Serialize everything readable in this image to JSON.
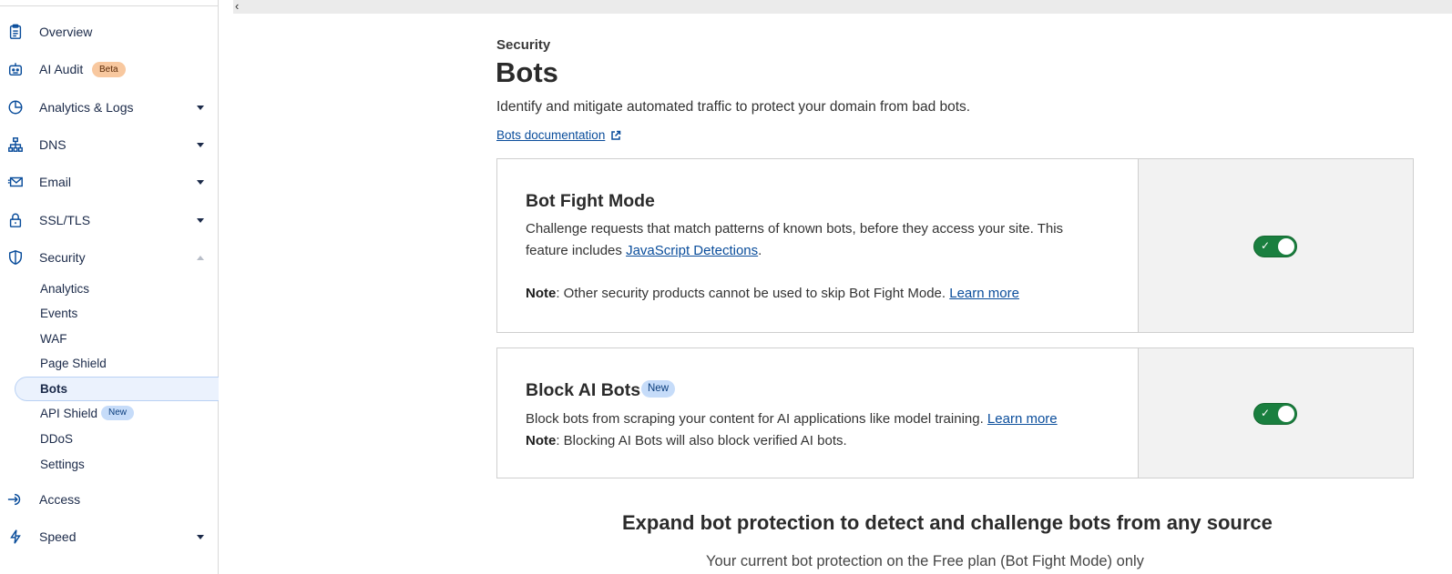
{
  "sidebar": {
    "items": [
      {
        "label": "Overview",
        "icon": "clipboard-icon"
      },
      {
        "label": "AI Audit",
        "icon": "robot-icon",
        "badge": "Beta"
      },
      {
        "label": "Analytics & Logs",
        "icon": "pie-chart-icon"
      },
      {
        "label": "DNS",
        "icon": "network-icon"
      },
      {
        "label": "Email",
        "icon": "envelope-icon"
      },
      {
        "label": "SSL/TLS",
        "icon": "lock-icon"
      },
      {
        "label": "Security",
        "icon": "shield-icon"
      },
      {
        "label": "Access",
        "icon": "access-icon"
      },
      {
        "label": "Speed",
        "icon": "lightning-icon"
      }
    ],
    "security_sub": [
      {
        "label": "Analytics"
      },
      {
        "label": "Events"
      },
      {
        "label": "WAF"
      },
      {
        "label": "Page Shield"
      },
      {
        "label": "Bots",
        "active": true
      },
      {
        "label": "API Shield",
        "badge": "New"
      },
      {
        "label": "DDoS"
      },
      {
        "label": "Settings"
      }
    ]
  },
  "page": {
    "eyebrow": "Security",
    "title": "Bots",
    "description": "Identify and mitigate automated traffic to protect your domain from bad bots.",
    "doc_link": "Bots documentation"
  },
  "cards": {
    "bot_fight": {
      "title": "Bot Fight Mode",
      "text1": "Challenge requests that match patterns of known bots, before they access your site. This",
      "text2_pre": "feature includes ",
      "text2_link": "JavaScript Detections",
      "text2_post": ".",
      "note_label": "Note",
      "note_text": ": Other security products cannot be used to skip Bot Fight Mode. ",
      "learn_more": "Learn more",
      "enabled": true
    },
    "block_ai": {
      "title": "Block AI Bots",
      "badge": "New",
      "text1": "Block bots from scraping your content for AI applications like model training. ",
      "learn_more": "Learn more",
      "note_label": "Note",
      "note_text": ": Blocking AI Bots will also block verified AI bots.",
      "enabled": true
    }
  },
  "expand": {
    "title": "Expand bot protection to detect and challenge bots from any source",
    "subtitle": "Your current bot protection on the Free plan (Bot Fight Mode) only"
  },
  "colors": {
    "accent": "#0a4d9b",
    "toggle_on": "#1a7f3f",
    "beta_badge": "#f8c89f",
    "new_badge": "#c6dcf9"
  }
}
